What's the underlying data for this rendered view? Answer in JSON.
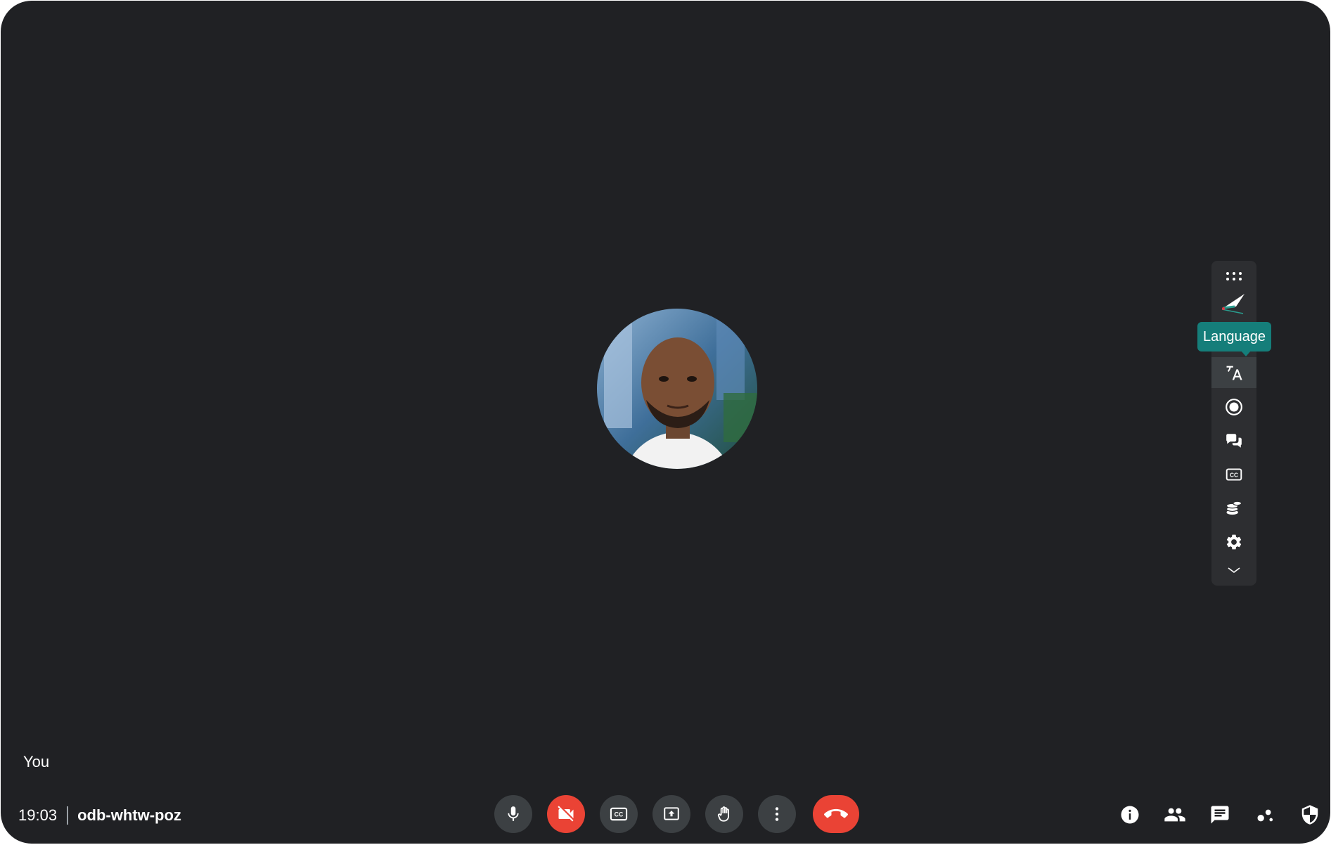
{
  "stage": {
    "self_label": "You"
  },
  "footer": {
    "time": "19:03",
    "meeting_code": "odb-whtw-poz"
  },
  "controls": [
    {
      "name": "mic-button",
      "icon": "microphone-icon",
      "state": "on"
    },
    {
      "name": "camera-button",
      "icon": "camera-off-icon",
      "state": "off"
    },
    {
      "name": "captions-button",
      "icon": "captions-icon"
    },
    {
      "name": "present-button",
      "icon": "present-screen-icon"
    },
    {
      "name": "raise-hand-button",
      "icon": "hand-icon"
    },
    {
      "name": "more-options-button",
      "icon": "more-vert-icon"
    },
    {
      "name": "leave-call-button",
      "icon": "hangup-icon"
    }
  ],
  "right_controls": [
    {
      "name": "meeting-details-button",
      "icon": "info-icon"
    },
    {
      "name": "people-button",
      "icon": "people-icon"
    },
    {
      "name": "chat-button",
      "icon": "chat-icon"
    },
    {
      "name": "activities-button",
      "icon": "activities-icon"
    },
    {
      "name": "host-controls-button",
      "icon": "shield-icon"
    }
  ],
  "side_toolbar": {
    "items": [
      "drag-handle-icon",
      "whiteboard-pen-icon",
      "translate-icon",
      "record-icon",
      "chat-bubbles-icon",
      "closed-captions-icon",
      "coins-icon",
      "settings-gear-icon",
      "chevron-down-icon"
    ],
    "active_item": "translate-icon",
    "tooltip": "Language"
  },
  "colors": {
    "background": "#202124",
    "control": "#3c4043",
    "danger": "#ea4335",
    "tooltip": "#157e7a"
  }
}
